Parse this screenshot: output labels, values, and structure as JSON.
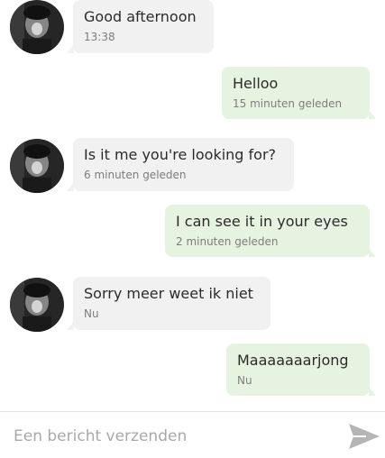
{
  "colors": {
    "incoming_bubble": "#f1f1f1",
    "outgoing_bubble": "#e6f3e0",
    "message_text": "#2b2b2b",
    "timestamp_text": "#7d7d7d",
    "placeholder_text": "#a9a9a9",
    "send_icon": "#b5b5b5"
  },
  "messages": [
    {
      "sender": "them",
      "text": "Good afternoon",
      "time": "13:38"
    },
    {
      "sender": "me",
      "text": "Helloo",
      "time": "15 minuten geleden"
    },
    {
      "sender": "them",
      "text": "Is it me you're looking for?",
      "time": "6 minuten geleden"
    },
    {
      "sender": "me",
      "text": "I can see it in your eyes",
      "time": "2 minuten geleden"
    },
    {
      "sender": "them",
      "text": "Sorry meer weet ik niet",
      "time": "Nu"
    },
    {
      "sender": "me",
      "text": "Maaaaaaarjong",
      "time": "Nu"
    }
  ],
  "composer": {
    "placeholder": "Een bericht verzenden",
    "send_icon": "send-icon"
  }
}
